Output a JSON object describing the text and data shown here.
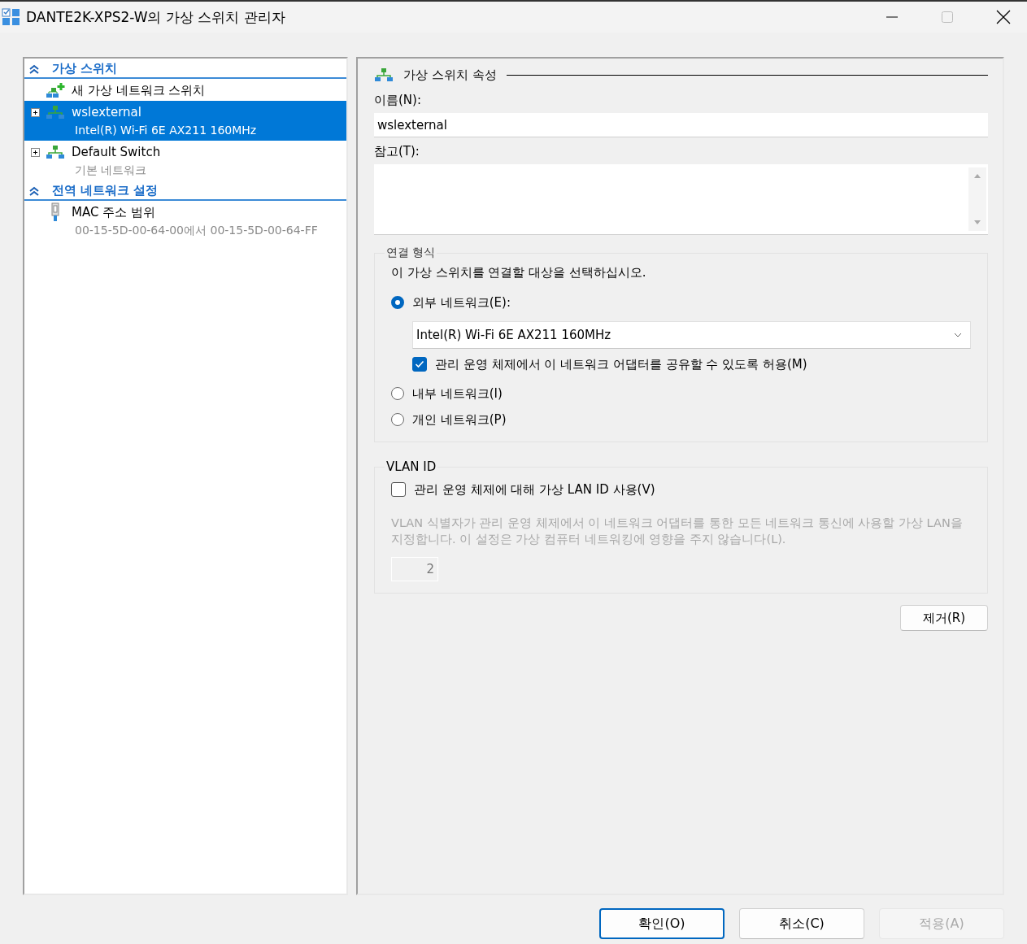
{
  "window": {
    "title": "DANTE2K-XPS2-W의 가상 스위치 관리자"
  },
  "sections": [
    {
      "label": "가상 스위치",
      "expanded": true,
      "items": [
        {
          "kind": "new",
          "label": "새 가상 네트워크 스위치",
          "selected": false
        },
        {
          "kind": "switch",
          "label": "wslexternal",
          "detail": "Intel(R) Wi-Fi 6E AX211 160MHz",
          "selected": true,
          "expanded": false
        },
        {
          "kind": "switch",
          "label": "Default Switch",
          "detail": "기본 네트워크",
          "selected": false,
          "expanded": false
        }
      ]
    },
    {
      "label": "전역 네트워크 설정",
      "expanded": true,
      "items": [
        {
          "kind": "mac",
          "label": "MAC 주소 범위",
          "detail": "00-15-5D-00-64-00에서 00-15-5D-00-64-FF",
          "selected": false
        }
      ]
    }
  ],
  "properties": {
    "title": "가상 스위치 속성",
    "name_label": "이름(N):",
    "name_value": "wslexternal",
    "notes_label": "참고(T):"
  },
  "connection": {
    "legend": "연결 형식",
    "prompt": "이 가상 스위치를 연결할 대상을 선택하십시오.",
    "options": [
      {
        "label": "외부 네트워크(E):",
        "selected": true,
        "adapter": "Intel(R) Wi-Fi 6E AX211 160MHz",
        "share": {
          "label": "관리 운영 체제에서 이 네트워크 어댑터를 공유할 수 있도록 허용(M)",
          "checked": true
        }
      },
      {
        "label": "내부 네트워크(I)",
        "selected": false
      },
      {
        "label": "개인 네트워크(P)",
        "selected": false
      }
    ]
  },
  "vlan": {
    "legend": "VLAN ID",
    "checkbox": {
      "label": "관리 운영 체제에 대해 가상 LAN ID 사용(V)",
      "checked": false
    },
    "description": "VLAN 식별자가 관리 운영 체제에서 이 네트워크 어댑터를 통한 모든 네트워크 통신에 사용할 가상 LAN을 지정합니다. 이 설정은 가상 컴퓨터 네트워킹에 영향을 주지 않습니다(L).",
    "value": "2",
    "disabled": true
  },
  "remove_button": "제거(R)",
  "buttons": [
    {
      "label": "확인(O)",
      "default": true,
      "disabled": false
    },
    {
      "label": "취소(C)",
      "default": false,
      "disabled": false
    },
    {
      "label": "적용(A)",
      "default": false,
      "disabled": true
    }
  ]
}
